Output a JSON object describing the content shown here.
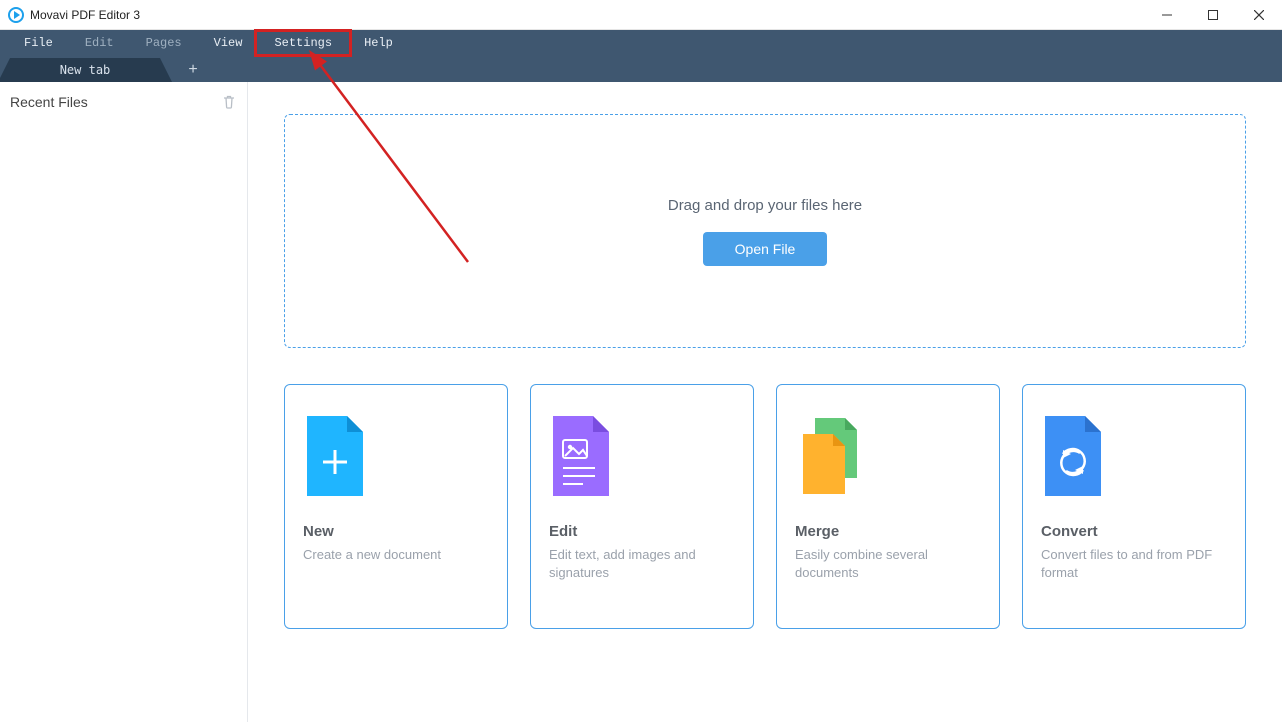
{
  "app": {
    "title": "Movavi PDF Editor 3"
  },
  "menu": {
    "items": [
      {
        "label": "File",
        "disabled": false
      },
      {
        "label": "Edit",
        "disabled": true
      },
      {
        "label": "Pages",
        "disabled": true
      },
      {
        "label": "View",
        "disabled": false
      },
      {
        "label": "Settings",
        "disabled": false,
        "highlighted": true
      },
      {
        "label": "Help",
        "disabled": false
      }
    ]
  },
  "tabs": {
    "items": [
      {
        "label": "New tab"
      }
    ]
  },
  "sidebar": {
    "title": "Recent Files"
  },
  "dropzone": {
    "text": "Drag and drop your files here",
    "button": "Open File"
  },
  "cards": [
    {
      "title": "New",
      "desc": "Create a new document"
    },
    {
      "title": "Edit",
      "desc": "Edit text, add images and signatures"
    },
    {
      "title": "Merge",
      "desc": "Easily combine several documents"
    },
    {
      "title": "Convert",
      "desc": "Convert files to and from PDF format"
    }
  ],
  "colors": {
    "accent": "#4aa0e8",
    "menubar": "#3f5770",
    "tab": "#273b4f",
    "highlight": "#d32222"
  }
}
